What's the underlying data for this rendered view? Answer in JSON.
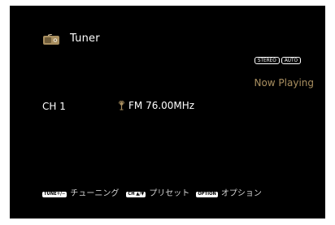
{
  "header": {
    "source_icon": "radio-icon",
    "title": "Tuner"
  },
  "status_badges": [
    "STEREO",
    "AUTO"
  ],
  "now_playing": "Now Playing",
  "channel": "CH 1",
  "frequency": {
    "icon": "broadcast-antenna-icon",
    "text": "FM 76.00MHz"
  },
  "footer": {
    "items": [
      {
        "key": "TUNE+/−",
        "label": "チューニング"
      },
      {
        "key": "CH ▲/▼",
        "label": "プリセット"
      },
      {
        "key": "OPTION",
        "label": "オプション"
      }
    ]
  },
  "colors": {
    "background": "#000000",
    "text": "#ffffff",
    "accent": "#a98f60",
    "icon": "#a98f60"
  }
}
